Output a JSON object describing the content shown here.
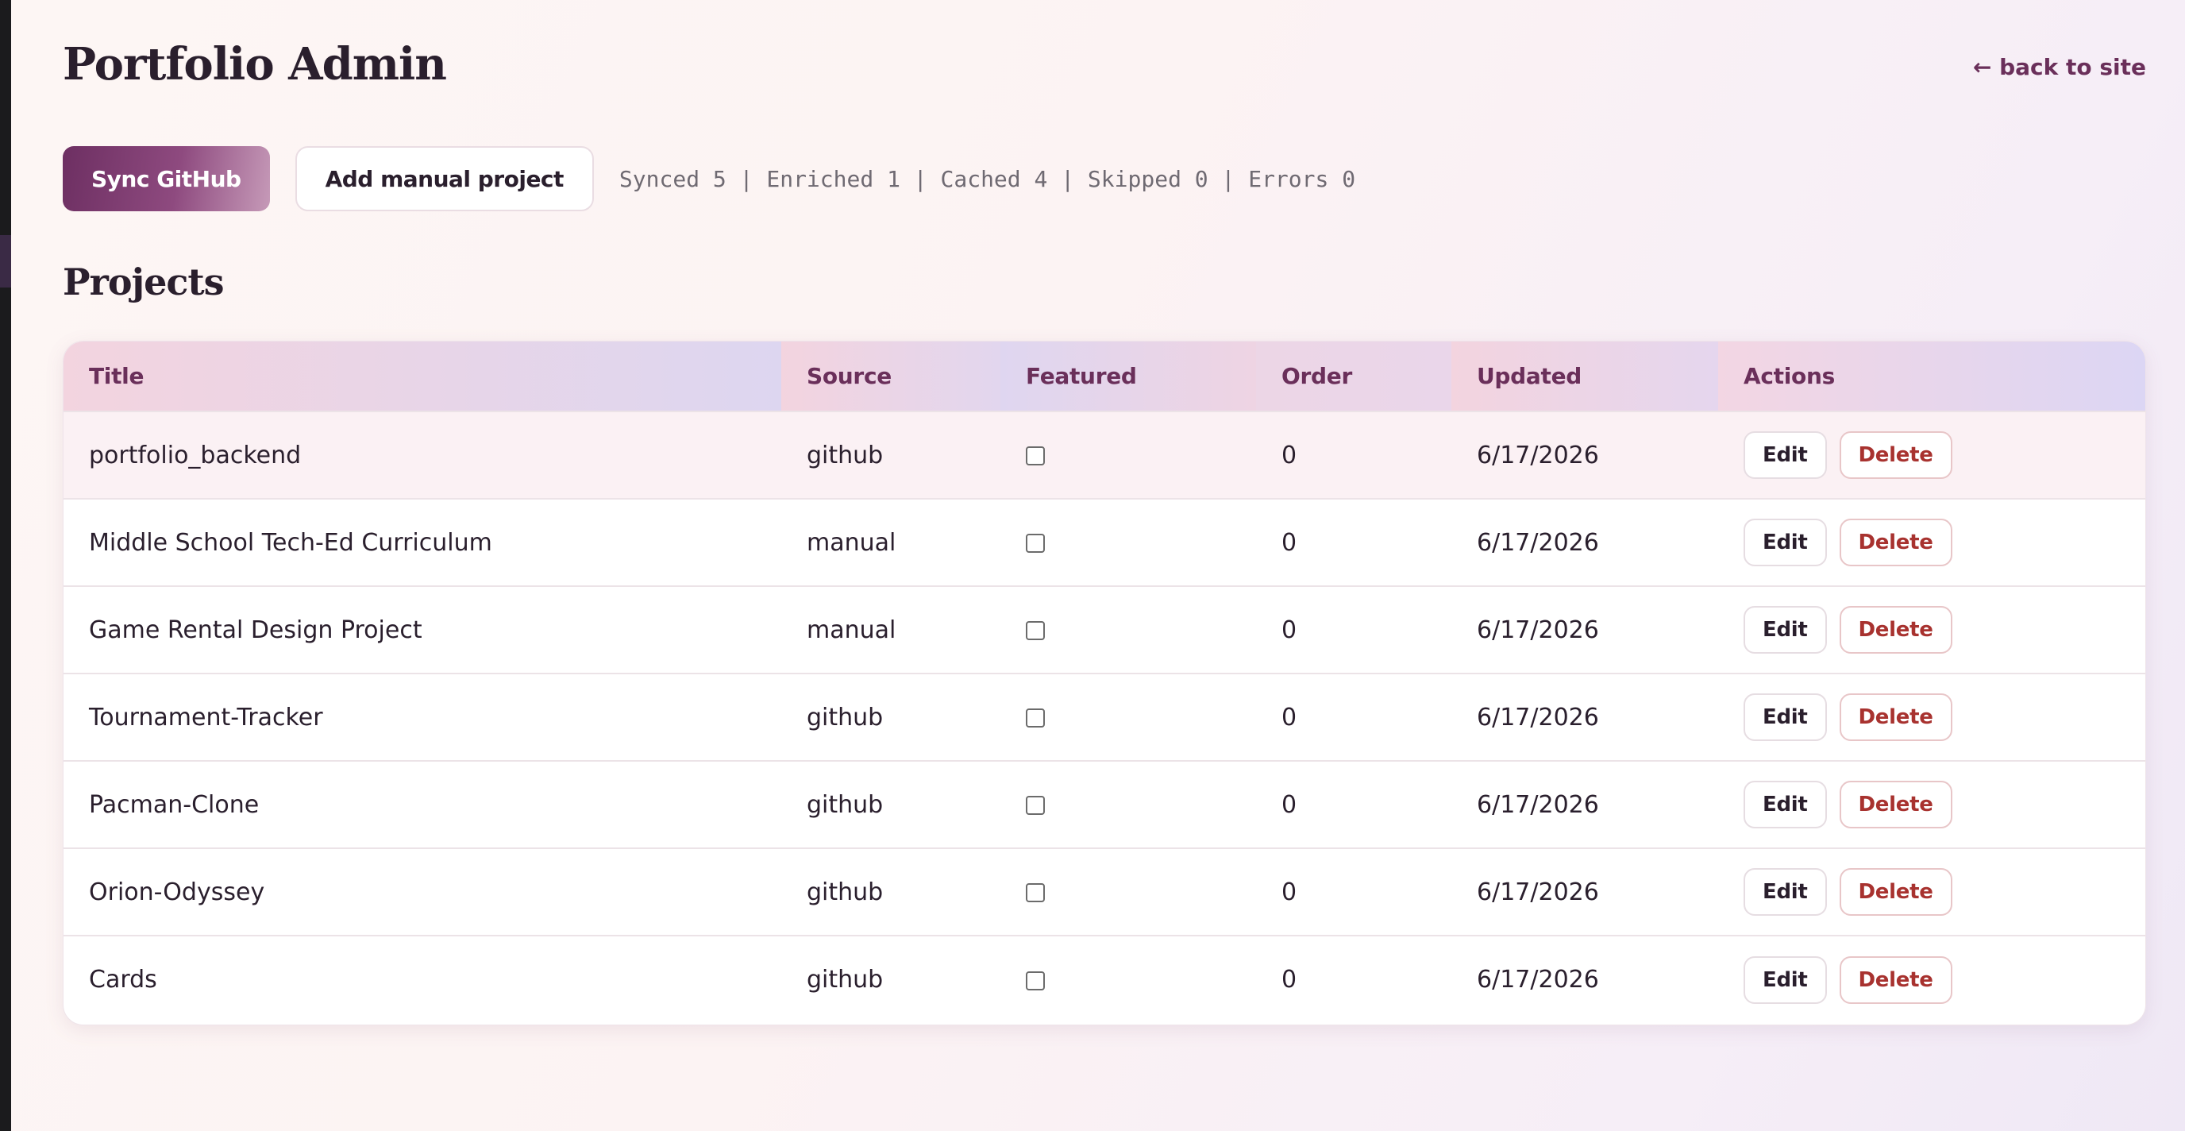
{
  "header": {
    "title": "Portfolio Admin",
    "back_link": "← back to site"
  },
  "toolbar": {
    "sync_label": "Sync GitHub",
    "add_label": "Add manual project",
    "status_text": "Synced 5 | Enriched 1 | Cached 4 | Skipped 0 | Errors 0"
  },
  "projects": {
    "heading": "Projects",
    "columns": [
      "Title",
      "Source",
      "Featured",
      "Order",
      "Updated",
      "Actions"
    ],
    "edit_label": "Edit",
    "delete_label": "Delete",
    "rows": [
      {
        "title": "portfolio_backend",
        "source": "github",
        "featured": false,
        "order": "0",
        "updated": "6/17/2026"
      },
      {
        "title": "Middle School Tech-Ed Curriculum",
        "source": "manual",
        "featured": false,
        "order": "0",
        "updated": "6/17/2026"
      },
      {
        "title": "Game Rental Design Project",
        "source": "manual",
        "featured": false,
        "order": "0",
        "updated": "6/17/2026"
      },
      {
        "title": "Tournament-Tracker",
        "source": "github",
        "featured": false,
        "order": "0",
        "updated": "6/17/2026"
      },
      {
        "title": "Pacman-Clone",
        "source": "github",
        "featured": false,
        "order": "0",
        "updated": "6/17/2026"
      },
      {
        "title": "Orion-Odyssey",
        "source": "github",
        "featured": false,
        "order": "0",
        "updated": "6/17/2026"
      },
      {
        "title": "Cards",
        "source": "github",
        "featured": false,
        "order": "0",
        "updated": "6/17/2026"
      }
    ]
  },
  "colors": {
    "accent": "#6a2f5a",
    "primary_button_start": "#6d2f62",
    "primary_button_end": "#c69ab8",
    "delete": "#a8322f",
    "row_highlight": "#fbf1f4"
  }
}
